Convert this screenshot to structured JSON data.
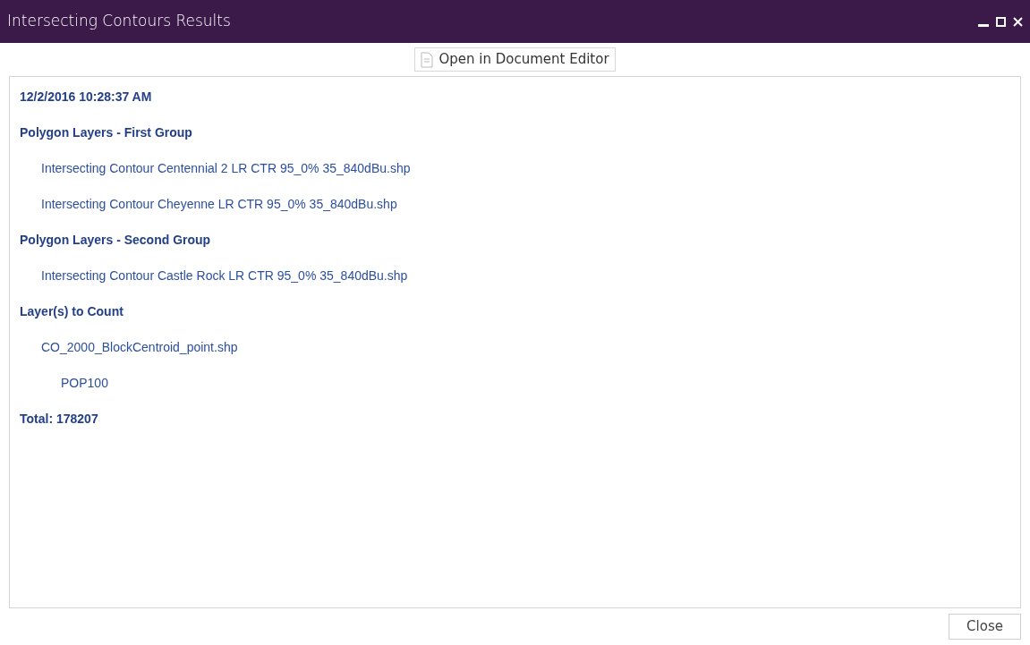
{
  "window": {
    "title": "Intersecting Contours Results"
  },
  "toolbar": {
    "open_button": "Open in Document Editor"
  },
  "report": {
    "timestamp": "12/2/2016 10:28:37 AM",
    "sections": [
      {
        "title": "Polygon Layers - First Group",
        "items": [
          {
            "text": "Intersecting Contour Centennial 2 LR CTR 95_0% 35_840dBu.shp"
          },
          {
            "text": "Intersecting Contour Cheyenne LR CTR 95_0% 35_840dBu.shp"
          }
        ]
      },
      {
        "title": "Polygon Layers - Second Group",
        "items": [
          {
            "text": "Intersecting Contour Castle Rock LR CTR 95_0% 35_840dBu.shp"
          }
        ]
      },
      {
        "title": "Layer(s) to Count",
        "items": [
          {
            "text": "CO_2000_BlockCentroid_point.shp",
            "children": [
              {
                "text": "POP100"
              }
            ]
          }
        ]
      }
    ],
    "total": "Total: 178207"
  },
  "footer": {
    "close_button": "Close"
  }
}
